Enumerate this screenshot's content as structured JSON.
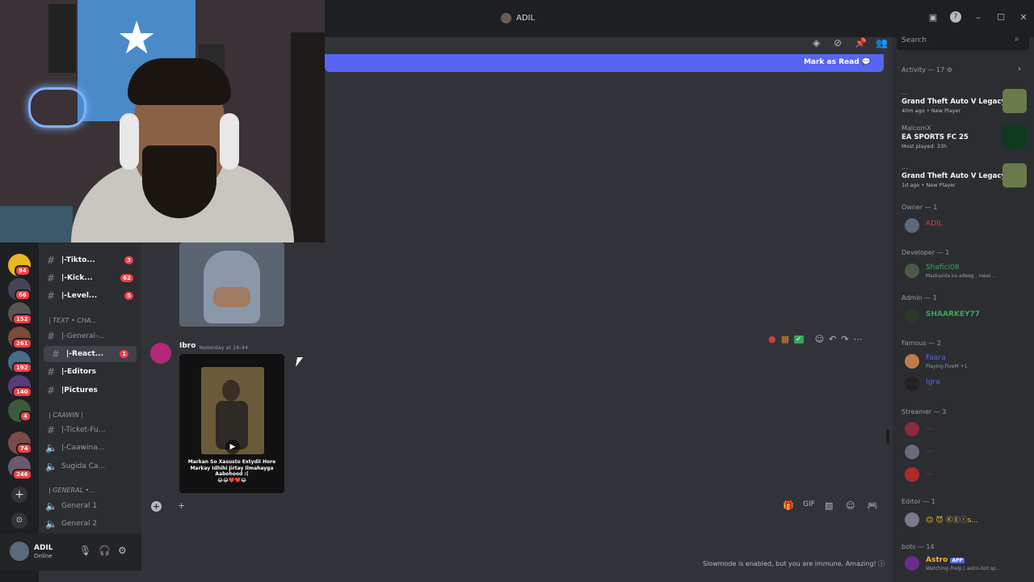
{
  "window": {
    "title": "ADIL",
    "controls": [
      "cast-icon",
      "help-icon",
      "minimize-icon",
      "maximize-icon",
      "close-icon"
    ]
  },
  "banner": {
    "mark_as_read": "Mark as Read"
  },
  "toolbar_icons": [
    "threads-icon",
    "mute-icon",
    "pin-icon",
    "members-icon"
  ],
  "search": {
    "placeholder": "Search"
  },
  "server_badges": [
    "94",
    "66",
    "152",
    "261",
    "192",
    "140",
    "4",
    "74",
    "246"
  ],
  "channels": [
    {
      "name": "|-Tikto...",
      "count": "3"
    },
    {
      "name": "|-Kick...",
      "count": "62"
    },
    {
      "name": "|-Level...",
      "count": "5"
    },
    {
      "category": "| TEXT • CHA..."
    },
    {
      "name": "|-General-..."
    },
    {
      "name": "|-React...",
      "count": "1"
    },
    {
      "name": "|-Editors"
    },
    {
      "name": "|Pictures"
    },
    {
      "category": "| CAAWIN |"
    },
    {
      "name": "|-Ticket-Fu..."
    },
    {
      "name": "|-Caawina..."
    },
    {
      "name": "Sugida Ca..."
    },
    {
      "category": "| GENERAL •..."
    },
    {
      "name": "General 1"
    },
    {
      "name": "General 2"
    }
  ],
  "user": {
    "name": "ADIL",
    "status": "Online"
  },
  "message": {
    "author": "Ibro",
    "timestamp": "Yesterday at 16:44",
    "caption": "Markan So Xasusto Extydii Hore Markay Idhihi Jirtay Ilmahayga Aabohood :(",
    "caption_emoji": "😂😂❤️❤️😂"
  },
  "composer": {
    "plus": "+"
  },
  "slowmode": "Slowmode is enabled, but you are immune. Amazing!",
  "members": {
    "activity_header": "Activity — 17",
    "activities": [
      {
        "who": "...",
        "game": "Grand Theft Auto V Legacy",
        "meta": "40m ago  •  New Player",
        "logo_color": "#6a7a4a"
      },
      {
        "who": "MalcomX",
        "game": "EA SPORTS FC 25",
        "meta": "Most played: 33h",
        "logo_color": "#0f3a1f"
      },
      {
        "who": "...",
        "game": "Grand Theft Auto V Legacy",
        "meta": "1d ago  •  New Player",
        "logo_color": "#6a7a4a"
      }
    ],
    "groups": [
      {
        "title": "Owner — 1",
        "items": [
          {
            "name": "ADIL",
            "color": "#e03a3a"
          }
        ]
      },
      {
        "title": "Developer — 1",
        "items": [
          {
            "name": "Shafici08",
            "color": "#3fa35a",
            "sub": "Maskaxda ka adeeg , meel ..."
          }
        ]
      },
      {
        "title": "Admin — 1",
        "items": [
          {
            "name": "SHAARKEY77",
            "color": "#3ba55d"
          }
        ]
      },
      {
        "title": "Famous — 2",
        "items": [
          {
            "name": "Faara",
            "color": "#5865f2",
            "sub": "Playing FiveM +1"
          },
          {
            "name": "Igra",
            "color": "#5865f2"
          }
        ]
      },
      {
        "title": "Streamer — 3",
        "items": [
          {
            "name": "...",
            "color": "#c4314b"
          },
          {
            "name": "...",
            "color": "#c4314b"
          },
          {
            "name": "...",
            "color": "#c4314b"
          }
        ]
      },
      {
        "title": "Editor — 1",
        "items": [
          {
            "name": "😊 😈 ⓀⒺⓡs...",
            "color": "#f0b232"
          }
        ]
      },
      {
        "title": "bots — 14",
        "items": [
          {
            "name": "Astro",
            "color": "#f0b232",
            "tag": "APP",
            "sub": "Watching /help | astro-bot.sp..."
          }
        ]
      }
    ]
  }
}
